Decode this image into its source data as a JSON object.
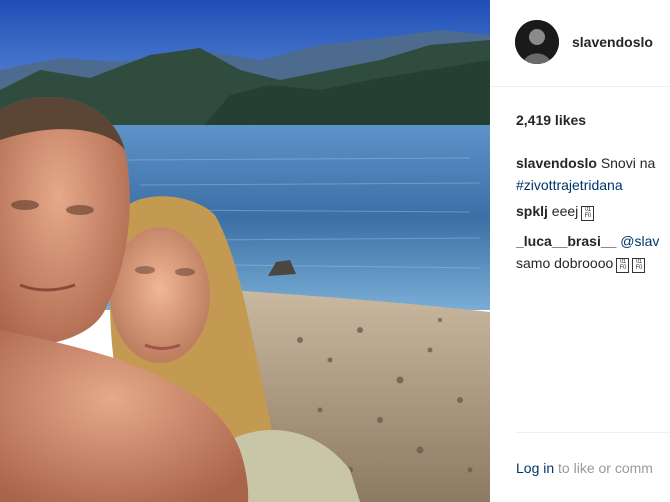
{
  "post": {
    "author": "slavendoslo",
    "likes": "2,419 likes",
    "caption": {
      "user": "slavendoslo",
      "text": "Snovi na",
      "hashtag": "#zivottrajetridana"
    },
    "comments": [
      {
        "user": "spklj",
        "text": "eeej",
        "emoji": "emoji-placeholder-icon"
      },
      {
        "user": "_luca__brasi__",
        "mention": "@slav",
        "text": "samo dobroooo",
        "emoji": "emoji-placeholder-icon"
      }
    ],
    "login": {
      "link": "Log in",
      "rest": "to like or comm"
    }
  },
  "colors": {
    "link_blue": "#003569",
    "text": "#262626",
    "muted": "#999999",
    "divider": "#efefef"
  }
}
